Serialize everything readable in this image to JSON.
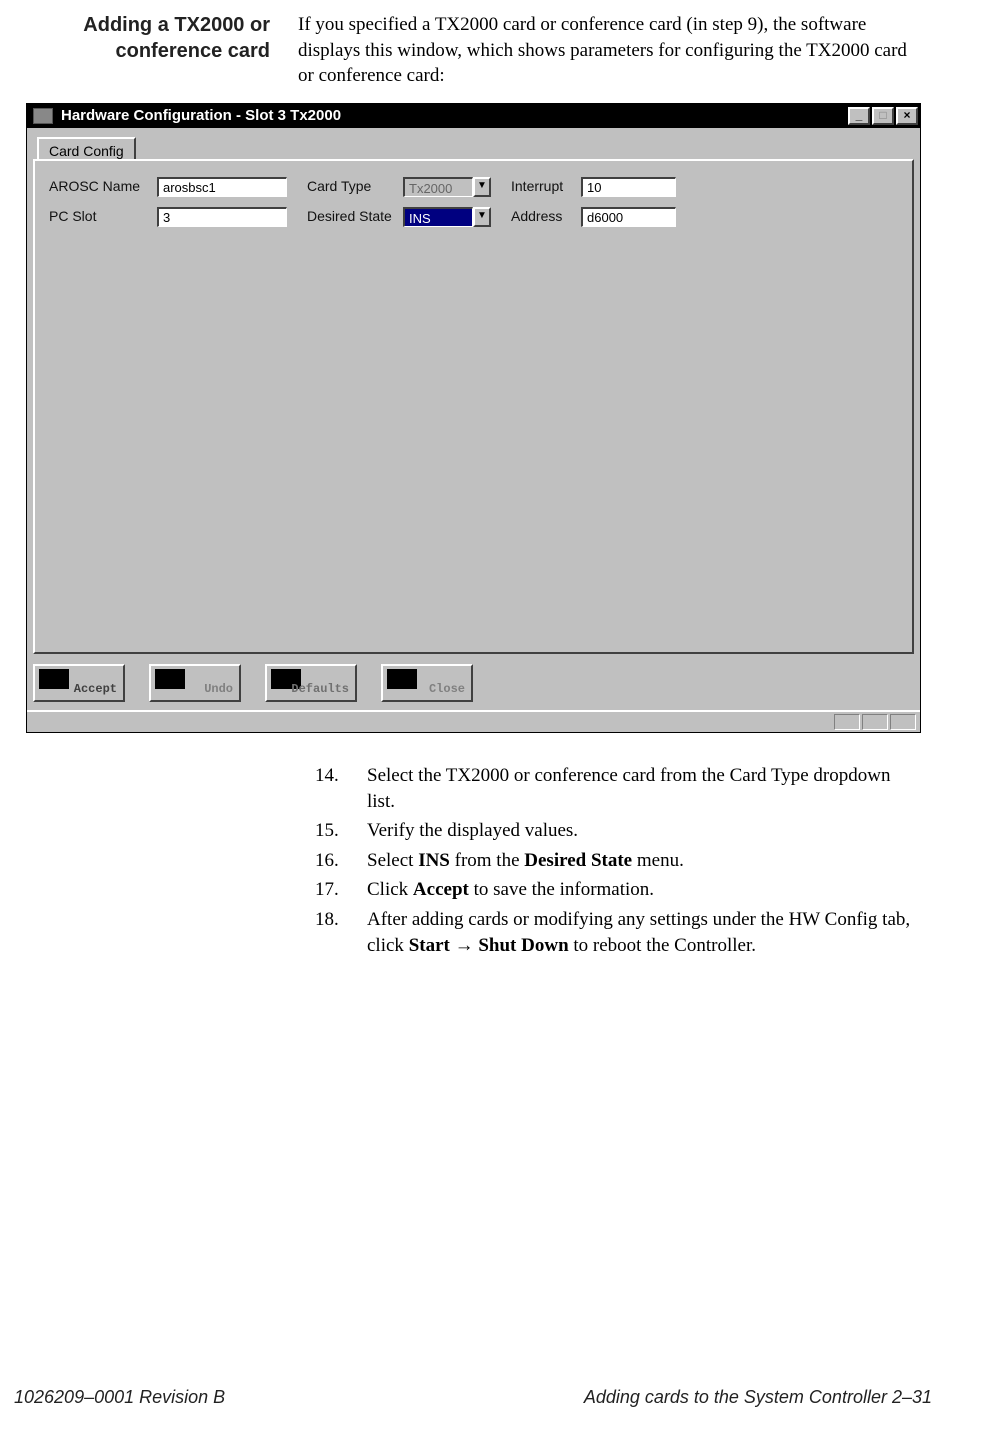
{
  "heading": "Adding a TX2000 or conference card",
  "intro": "If you specified a TX2000 card or conference card (in step 9), the software displays this window, which shows parameters for configuring the TX2000 card or conference card:",
  "window": {
    "title": "Hardware Configuration - Slot 3 Tx2000",
    "tab": "Card Config",
    "fields": {
      "arosc_label": "AROSC Name",
      "arosc_value": "arosbsc1",
      "pcslot_label": "PC Slot",
      "pcslot_value": "3",
      "cardtype_label": "Card Type",
      "cardtype_value": "Tx2000",
      "desiredstate_label": "Desired State",
      "desiredstate_value": "INS",
      "interrupt_label": "Interrupt",
      "interrupt_value": "10",
      "address_label": "Address",
      "address_value": "d6000"
    },
    "buttons": {
      "accept": "Accept",
      "undo": "Undo",
      "defaults": "Defaults",
      "close": "Close"
    },
    "minimize": "_",
    "maximize": "□",
    "closebtn": "×"
  },
  "steps": {
    "s14_num": "14.",
    "s14": "Select the TX2000 or conference card from the Card Type dropdown list.",
    "s15_num": "15.",
    "s15": "Verify the displayed values.",
    "s16_num": "16.",
    "s16_a": "Select ",
    "s16_b": "INS",
    "s16_c": " from the ",
    "s16_d": "Desired State",
    "s16_e": " menu.",
    "s17_num": "17.",
    "s17_a": "Click ",
    "s17_b": "Accept",
    "s17_c": " to save the information.",
    "s18_num": "18.",
    "s18_a": "After adding cards or modifying any settings under the HW Config tab, click ",
    "s18_b": "Start",
    "s18_c": " → ",
    "s18_d": "Shut Down",
    "s18_e": " to reboot the Controller."
  },
  "footer": {
    "left": "1026209–0001  Revision B",
    "right": "Adding cards to the System Controller   2–31"
  }
}
